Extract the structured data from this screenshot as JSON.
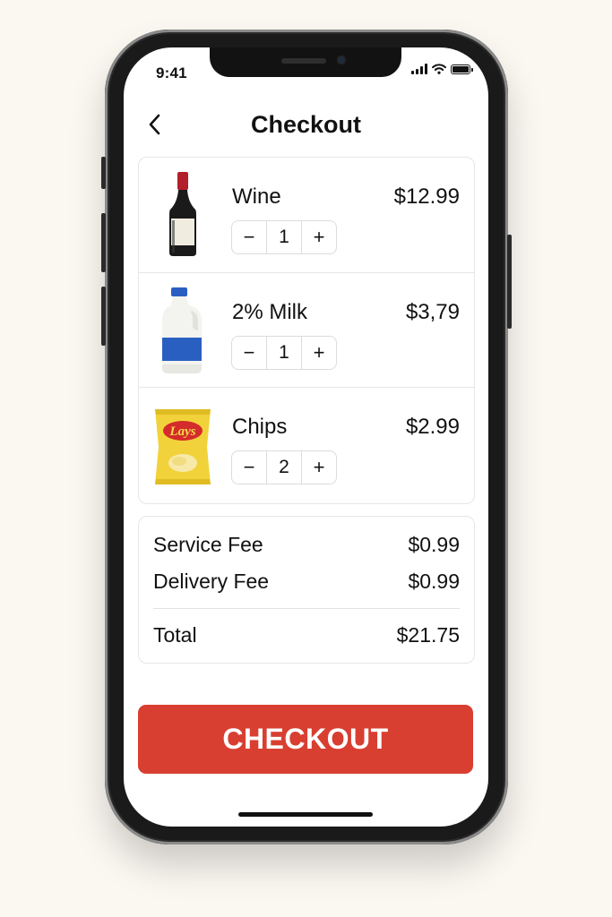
{
  "status_bar": {
    "time": "9:41",
    "icons": [
      "signal-icon",
      "wifi-icon",
      "battery-icon"
    ]
  },
  "header": {
    "title": "Checkout",
    "back_icon": "chevron-left-icon"
  },
  "cart": {
    "items": [
      {
        "name": "Wine",
        "price": "$12.99",
        "quantity": "1",
        "image": "wine-bottle-image"
      },
      {
        "name": "2% Milk",
        "price": "$3,79",
        "quantity": "1",
        "image": "milk-jug-image"
      },
      {
        "name": "Chips",
        "price": "$2.99",
        "quantity": "2",
        "image": "chips-bag-image",
        "brand": "Lays"
      }
    ],
    "minus_label": "−",
    "plus_label": "+"
  },
  "summary": {
    "service_fee_label": "Service Fee",
    "service_fee": "$0.99",
    "delivery_fee_label": "Delivery Fee",
    "delivery_fee": "$0.99",
    "total_label": "Total",
    "total": "$21.75"
  },
  "checkout_button": {
    "label": "CHECKOUT",
    "color": "#d83f31"
  }
}
